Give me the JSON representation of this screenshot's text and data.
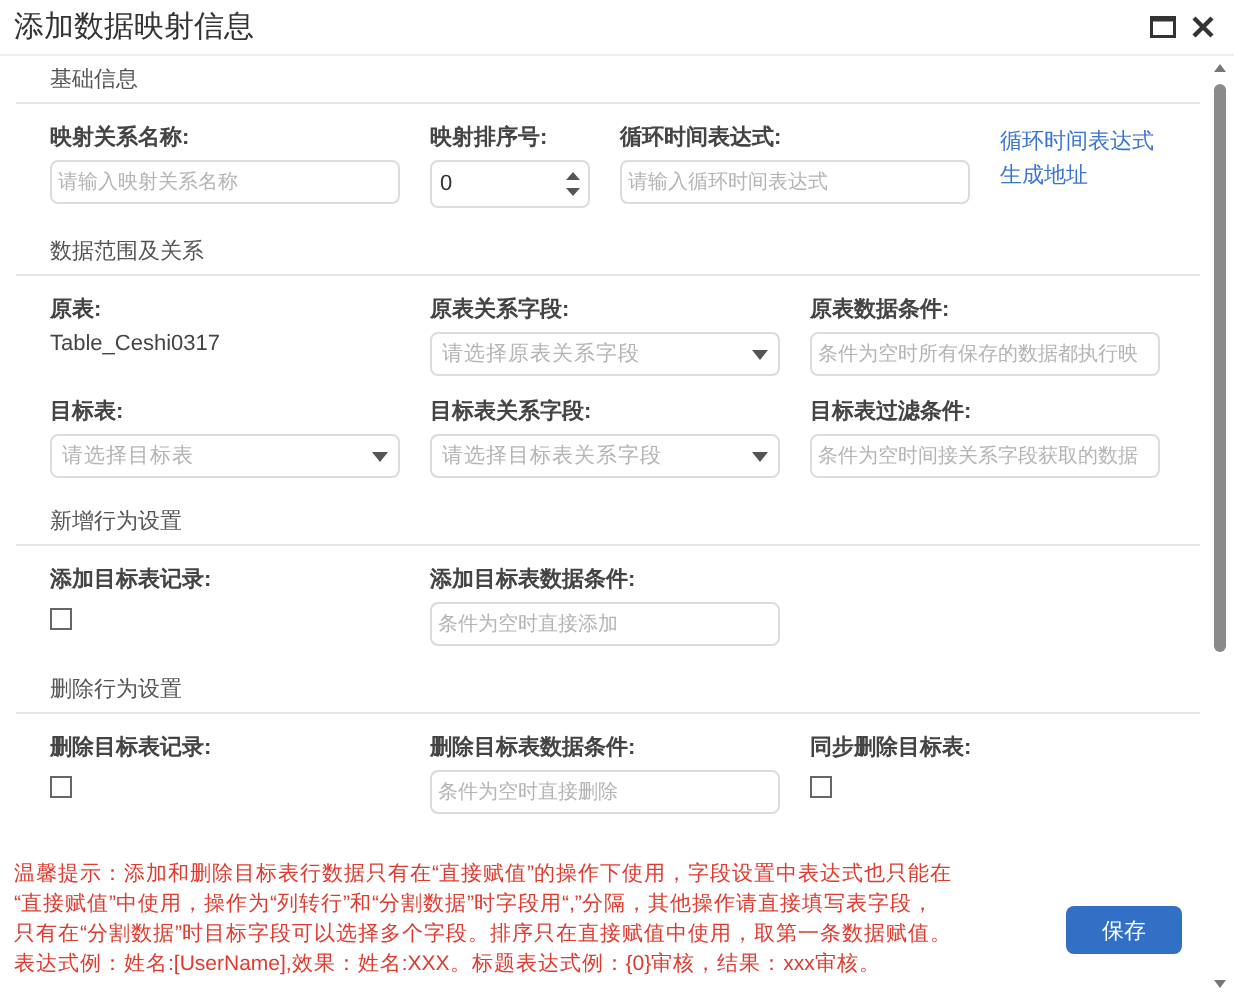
{
  "window": {
    "title": "添加数据映射信息"
  },
  "sections": [
    {
      "title": "基础信息",
      "fields": [
        {
          "kind": "text",
          "label": "映射关系名称:",
          "placeholder": "请输入映射关系名称"
        },
        {
          "kind": "number",
          "label": "映射排序号:",
          "value": "0"
        },
        {
          "kind": "text",
          "label": "循环时间表达式:",
          "placeholder": "请输入循环时间表达式"
        },
        {
          "kind": "link",
          "lines": [
            "循环时间表达式",
            "生成地址"
          ]
        }
      ]
    },
    {
      "title": "数据范围及关系",
      "fields": [
        {
          "kind": "static",
          "label": "原表:",
          "value": "Table_Ceshi0317"
        },
        {
          "kind": "select",
          "label": "原表关系字段:",
          "placeholder": "请选择原表关系字段"
        },
        {
          "kind": "text",
          "label": "原表数据条件:",
          "placeholder": "条件为空时所有保存的数据都执行映"
        },
        {
          "kind": "select",
          "label": "目标表:",
          "placeholder": "请选择目标表"
        },
        {
          "kind": "select",
          "label": "目标表关系字段:",
          "placeholder": "请选择目标表关系字段"
        },
        {
          "kind": "text",
          "label": "目标表过滤条件:",
          "placeholder": "条件为空时间接关系字段获取的数据"
        }
      ]
    },
    {
      "title": "新增行为设置",
      "fields": [
        {
          "kind": "checkbox",
          "label": "添加目标表记录:",
          "checked": false
        },
        {
          "kind": "text",
          "label": "添加目标表数据条件:",
          "placeholder": "条件为空时直接添加"
        }
      ]
    },
    {
      "title": "删除行为设置",
      "fields": [
        {
          "kind": "checkbox",
          "label": "删除目标表记录:",
          "checked": false
        },
        {
          "kind": "text",
          "label": "删除目标表数据条件:",
          "placeholder": "条件为空时直接删除"
        },
        {
          "kind": "checkbox",
          "label": "同步删除目标表:",
          "checked": false
        }
      ]
    }
  ],
  "hint": [
    "温馨提示：添加和删除目标表行数据只有在“直接赋值”的操作下使用，字段设置中表达式也只能在",
    "“直接赋值”中使用，操作为“列转行”和“分割数据”时字段用“,”分隔，其他操作请直接填写表字段，",
    "只有在“分割数据”时目标字段可以选择多个字段。排序只在直接赋值中使用，取第一条数据赋值。",
    "表达式例：姓名:[UserName],效果：姓名:XXX。标题表达式例：{0}审核，结果：xxx审核。"
  ],
  "save_button": "保存"
}
